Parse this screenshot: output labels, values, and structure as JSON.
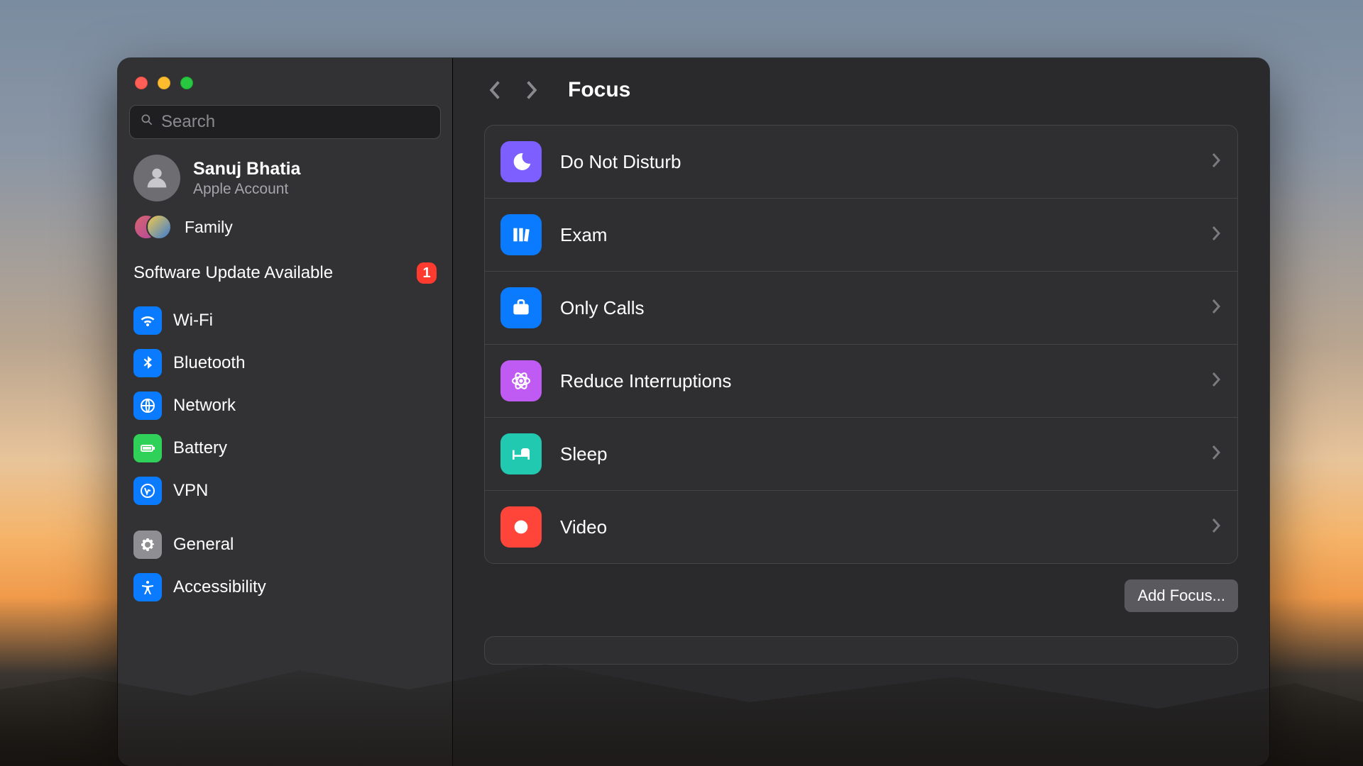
{
  "search": {
    "placeholder": "Search"
  },
  "account": {
    "name": "Sanuj Bhatia",
    "sub": "Apple Account"
  },
  "family": {
    "label": "Family"
  },
  "update": {
    "label": "Software Update Available",
    "badge": "1"
  },
  "sidebar": {
    "group1": [
      {
        "label": "Wi-Fi",
        "color": "#0a7aff",
        "icon": "wifi"
      },
      {
        "label": "Bluetooth",
        "color": "#0a7aff",
        "icon": "bluetooth"
      },
      {
        "label": "Network",
        "color": "#0a7aff",
        "icon": "globe"
      },
      {
        "label": "Battery",
        "color": "#30d158",
        "icon": "battery"
      },
      {
        "label": "VPN",
        "color": "#0a7aff",
        "icon": "vpn"
      }
    ],
    "group2": [
      {
        "label": "General",
        "color": "#8e8e93",
        "icon": "gear"
      },
      {
        "label": "Accessibility",
        "color": "#0a7aff",
        "icon": "accessibility"
      }
    ]
  },
  "header": {
    "title": "Focus"
  },
  "focus": {
    "items": [
      {
        "label": "Do Not Disturb",
        "color": "#7d5fff",
        "icon": "moon"
      },
      {
        "label": "Exam",
        "color": "#0a7aff",
        "icon": "books"
      },
      {
        "label": "Only Calls",
        "color": "#0a7aff",
        "icon": "briefcase"
      },
      {
        "label": "Reduce Interruptions",
        "color": "#bf5af2",
        "icon": "atom"
      },
      {
        "label": "Sleep",
        "color": "#20c9b0",
        "icon": "bed"
      },
      {
        "label": "Video",
        "color": "#ff453a",
        "icon": "record"
      }
    ],
    "add_button": "Add Focus..."
  }
}
